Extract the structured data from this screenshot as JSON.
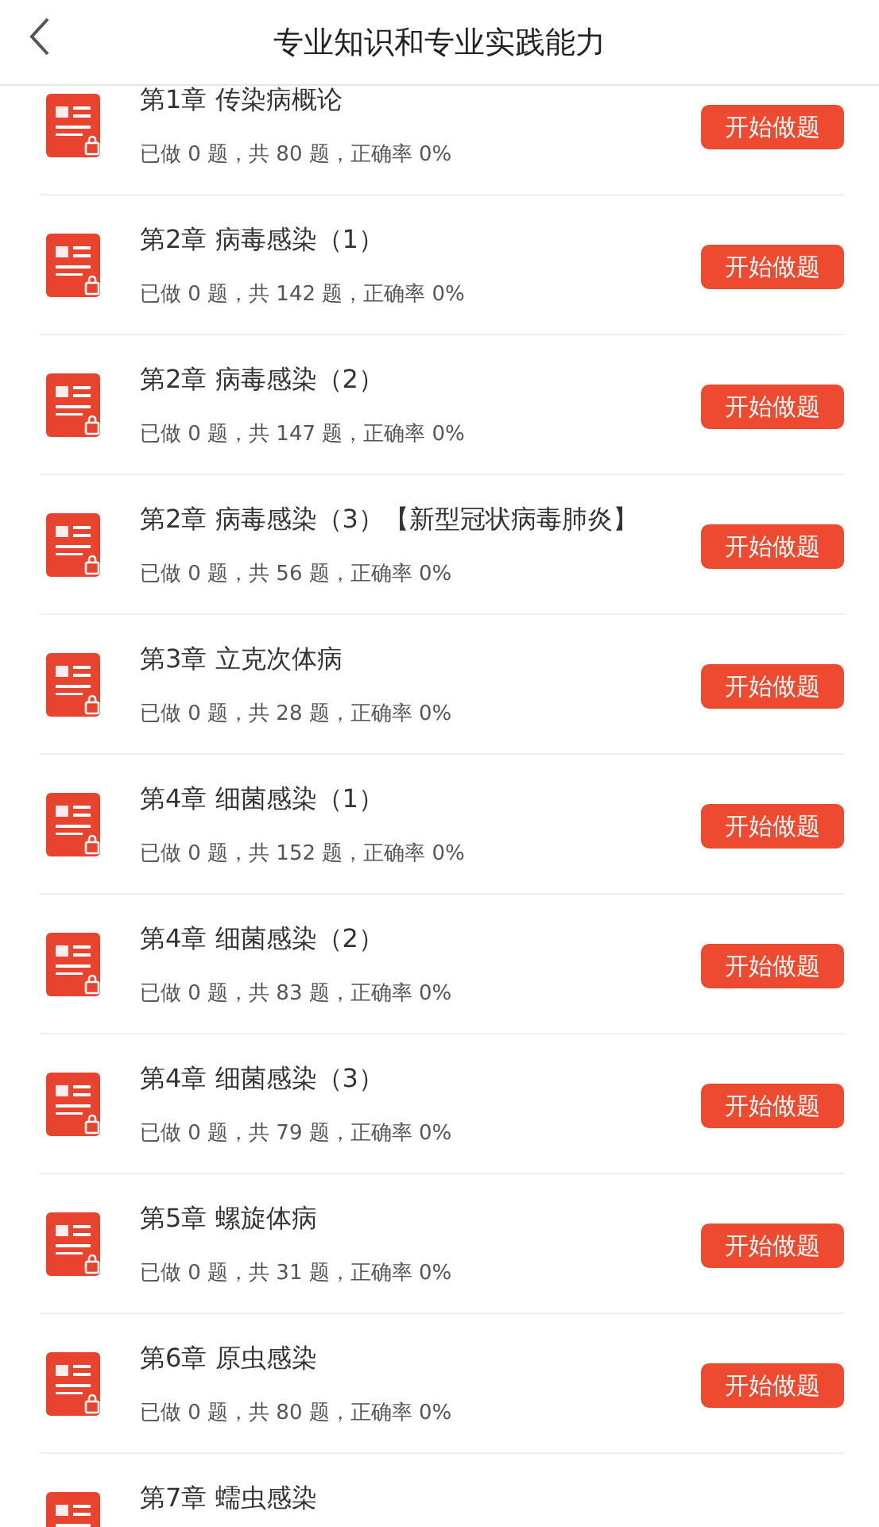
{
  "header": {
    "title": "专业知识和专业实践能力"
  },
  "chapters": [
    {
      "title": "第1章 传染病概论",
      "stats": "已做 0 题，共 80 题，正确率 0%",
      "button": "开始做题"
    },
    {
      "title": "第2章 病毒感染（1）",
      "stats": "已做 0 题，共 142 题，正确率 0%",
      "button": "开始做题"
    },
    {
      "title": "第2章 病毒感染（2）",
      "stats": "已做 0 题，共 147 题，正确率 0%",
      "button": "开始做题"
    },
    {
      "title": "第2章 病毒感染（3）【新型冠状病毒肺炎】",
      "stats": "已做 0 题，共 56 题，正确率 0%",
      "button": "开始做题"
    },
    {
      "title": "第3章 立克次体病",
      "stats": "已做 0 题，共 28 题，正确率 0%",
      "button": "开始做题"
    },
    {
      "title": "第4章 细菌感染（1）",
      "stats": "已做 0 题，共 152 题，正确率 0%",
      "button": "开始做题"
    },
    {
      "title": "第4章 细菌感染（2）",
      "stats": "已做 0 题，共 83 题，正确率 0%",
      "button": "开始做题"
    },
    {
      "title": "第4章 细菌感染（3）",
      "stats": "已做 0 题，共 79 题，正确率 0%",
      "button": "开始做题"
    },
    {
      "title": "第5章 螺旋体病",
      "stats": "已做 0 题，共 31 题，正确率 0%",
      "button": "开始做题"
    },
    {
      "title": "第6章 原虫感染",
      "stats": "已做 0 题，共 80 题，正确率 0%",
      "button": "开始做题"
    },
    {
      "title": "第7章 蠕虫感染"
    }
  ]
}
